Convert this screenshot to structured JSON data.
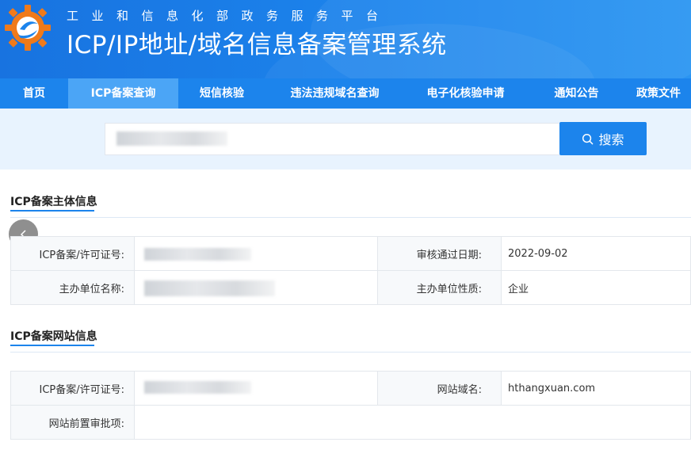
{
  "header": {
    "ministry": "工业和信息化部政务服务平台",
    "system_title": "ICP/IP地址/域名信息备案管理系统",
    "logo_icon": "gear-logo-icon"
  },
  "nav": {
    "items": [
      {
        "label": "首页",
        "active": false
      },
      {
        "label": "ICP备案查询",
        "active": true
      },
      {
        "label": "短信核验",
        "active": false
      },
      {
        "label": "违法违规域名查询",
        "active": false
      },
      {
        "label": "电子化核验申请",
        "active": false
      },
      {
        "label": "通知公告",
        "active": false
      },
      {
        "label": "政策文件",
        "active": false
      }
    ]
  },
  "search": {
    "button_label": "搜索",
    "button_icon": "search-icon"
  },
  "subject_section": {
    "title": "ICP备案主体信息",
    "rows": [
      {
        "label1": "ICP备案/许可证号:",
        "label2": "审核通过日期:",
        "value2": "2022-09-02"
      },
      {
        "label1": "主办单位名称:",
        "label2": "主办单位性质:",
        "value2": "企业"
      }
    ]
  },
  "website_section": {
    "title": "ICP备案网站信息",
    "rows": [
      {
        "label1": "ICP备案/许可证号:",
        "label2": "网站域名:",
        "value2": "hthangxuan.com"
      },
      {
        "label1": "网站前置审批项:"
      }
    ]
  },
  "colors": {
    "primary": "#1c84ec",
    "active_tab": "#4ba5f6",
    "search_band": "#e8f3fe"
  }
}
